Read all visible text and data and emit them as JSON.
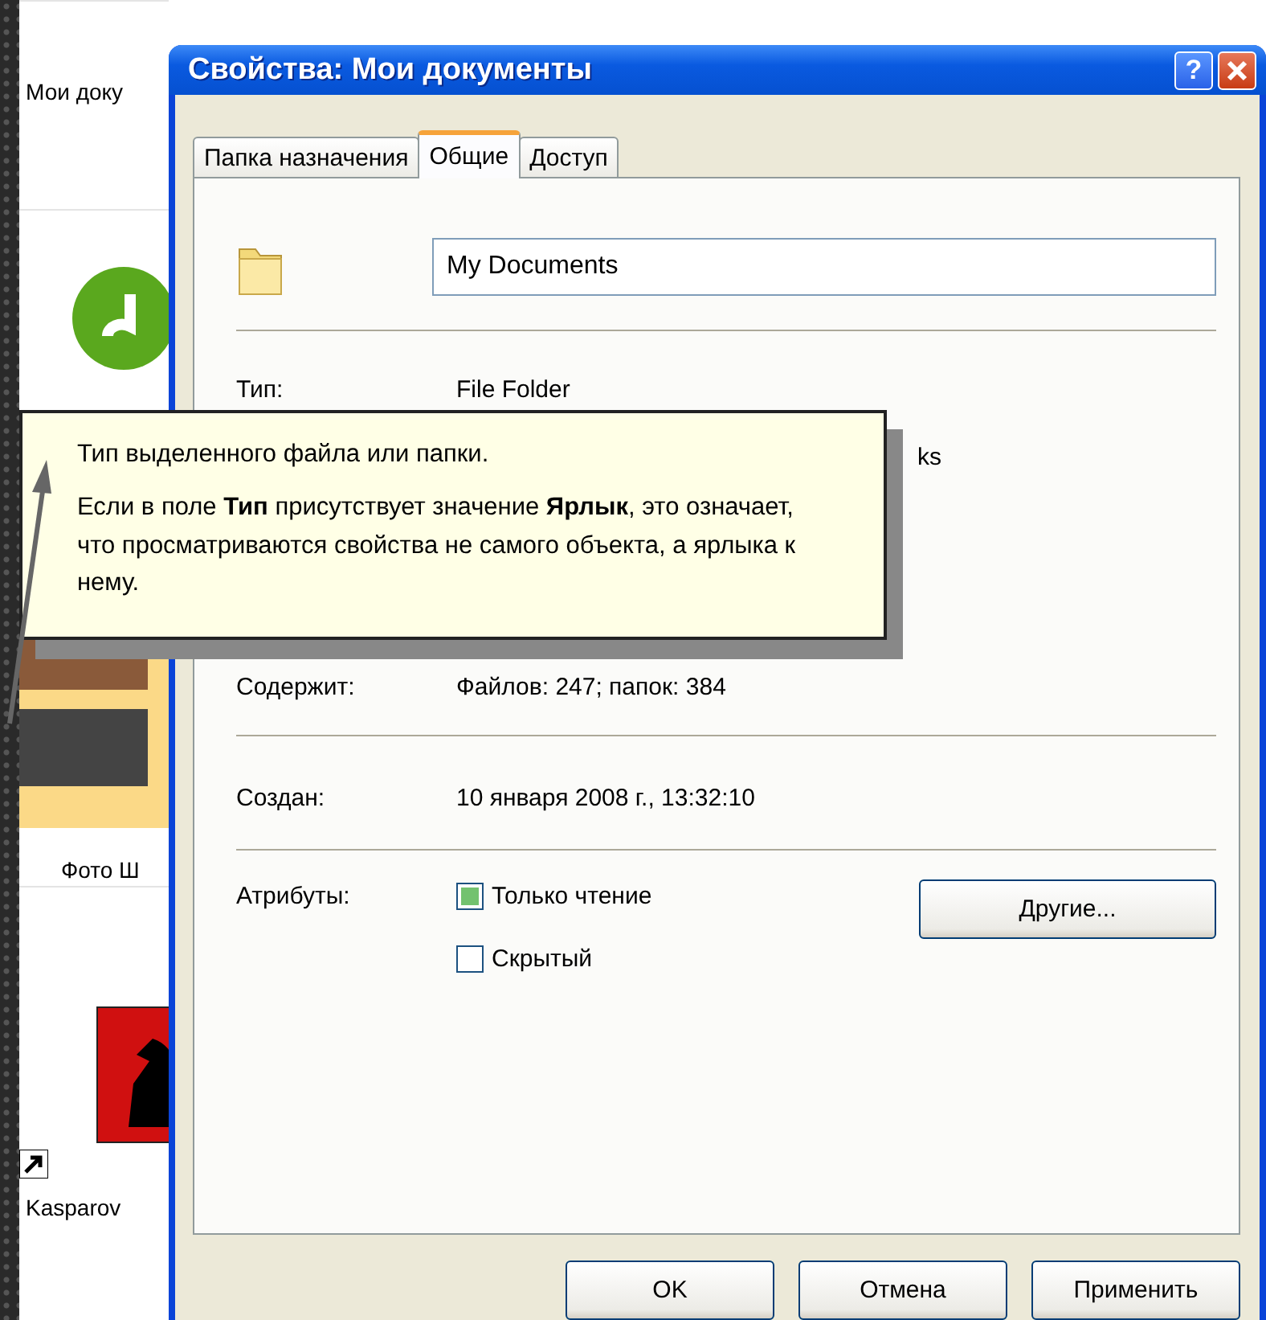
{
  "explorer": {
    "items": [
      {
        "kind": "label",
        "text": "Мои доку"
      },
      {
        "kind": "app"
      },
      {
        "kind": "photos",
        "text": "Фото Ш"
      },
      {
        "kind": "chess",
        "text": "Kasparov"
      }
    ]
  },
  "window": {
    "title": "Свойства: Мои документы",
    "help_button": "?"
  },
  "tabs": [
    {
      "label": "Папка назначения",
      "selected": false
    },
    {
      "label": "Общие",
      "selected": true
    },
    {
      "label": "Доступ",
      "selected": false
    }
  ],
  "name_field": {
    "value": "My Documents"
  },
  "type_row": {
    "label": "Тип:",
    "value": "File Folder"
  },
  "covered_fragment": "ks",
  "info_rows": [
    {
      "label": "Содержит:",
      "value": "Файлов: 247; папок: 384"
    },
    {
      "label": "Создан:",
      "value": "10 января 2008 г., 13:32:10"
    }
  ],
  "attributes": {
    "label": "Атрибуты:",
    "options": [
      {
        "label": "Только чтение",
        "checked": true
      },
      {
        "label": "Скрытый",
        "checked": false
      }
    ],
    "button": "Другие..."
  },
  "buttons": [
    "OK",
    "Отмена",
    "Применить"
  ],
  "tooltip": {
    "paragraphs": [
      "Тип выделенного файла или папки.",
      "Если в поле **Тип** присутствует значение **Ярлык**, это означает, что просматриваются свойства не самого объекта, а ярлыка к нему."
    ]
  }
}
